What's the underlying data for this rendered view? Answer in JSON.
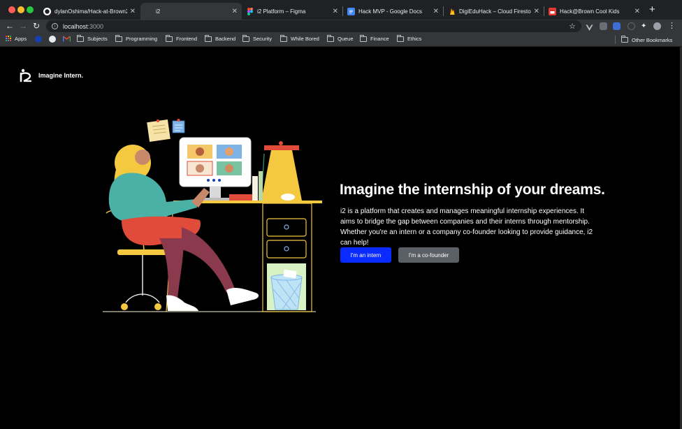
{
  "browser": {
    "tabs": [
      {
        "title": "dylanOshima/Hack-at-Brown2",
        "icon": "github-icon",
        "active": false
      },
      {
        "title": "i2",
        "icon": "page-icon",
        "active": true
      },
      {
        "title": "i2 Platform – Figma",
        "icon": "figma-icon",
        "active": false
      },
      {
        "title": "Hack MVP - Google Docs",
        "icon": "docs-icon",
        "active": false
      },
      {
        "title": "DigiEduHack – Cloud Firestore",
        "icon": "firebase-icon",
        "active": false
      },
      {
        "title": "Hack@Brown Cool Kids",
        "icon": "calendar-icon",
        "active": false
      }
    ],
    "new_tab": "+",
    "url_host": "localhost",
    "url_port": ":3000",
    "bookmarks": [
      {
        "label": "Apps",
        "icon": "apps-grid-icon"
      },
      {
        "label": "",
        "icon": "globe-icon"
      },
      {
        "label": "",
        "icon": "gmail-icon"
      },
      {
        "label": "Subjects",
        "icon": "folder-icon"
      },
      {
        "label": "Programming",
        "icon": "folder-icon"
      },
      {
        "label": "Frontend",
        "icon": "folder-icon"
      },
      {
        "label": "Backend",
        "icon": "folder-icon"
      },
      {
        "label": "Security",
        "icon": "folder-icon"
      },
      {
        "label": "While Bored",
        "icon": "folder-icon"
      },
      {
        "label": "Queue",
        "icon": "folder-icon"
      },
      {
        "label": "Finance",
        "icon": "folder-icon"
      },
      {
        "label": "Ethics",
        "icon": "folder-icon"
      }
    ],
    "other_bookmarks": "Other Bookmarks"
  },
  "page": {
    "logo_text": "Imagine Intern.",
    "hero_title": "Imagine the internship of your dreams.",
    "hero_description": "i2 is a platform that creates and manages meaningful internship experiences. It aims to bridge the gap between companies and their interns through mentorship. Whether you're an intern or a company co-founder looking to provide guidance, i2 can help!",
    "intern_button": "I'm an intern",
    "cofounder_button": "I'm a co-founder"
  },
  "colors": {
    "primary_button": "#0a2bff",
    "secondary_button": "#5b5f66",
    "background": "#000000"
  }
}
